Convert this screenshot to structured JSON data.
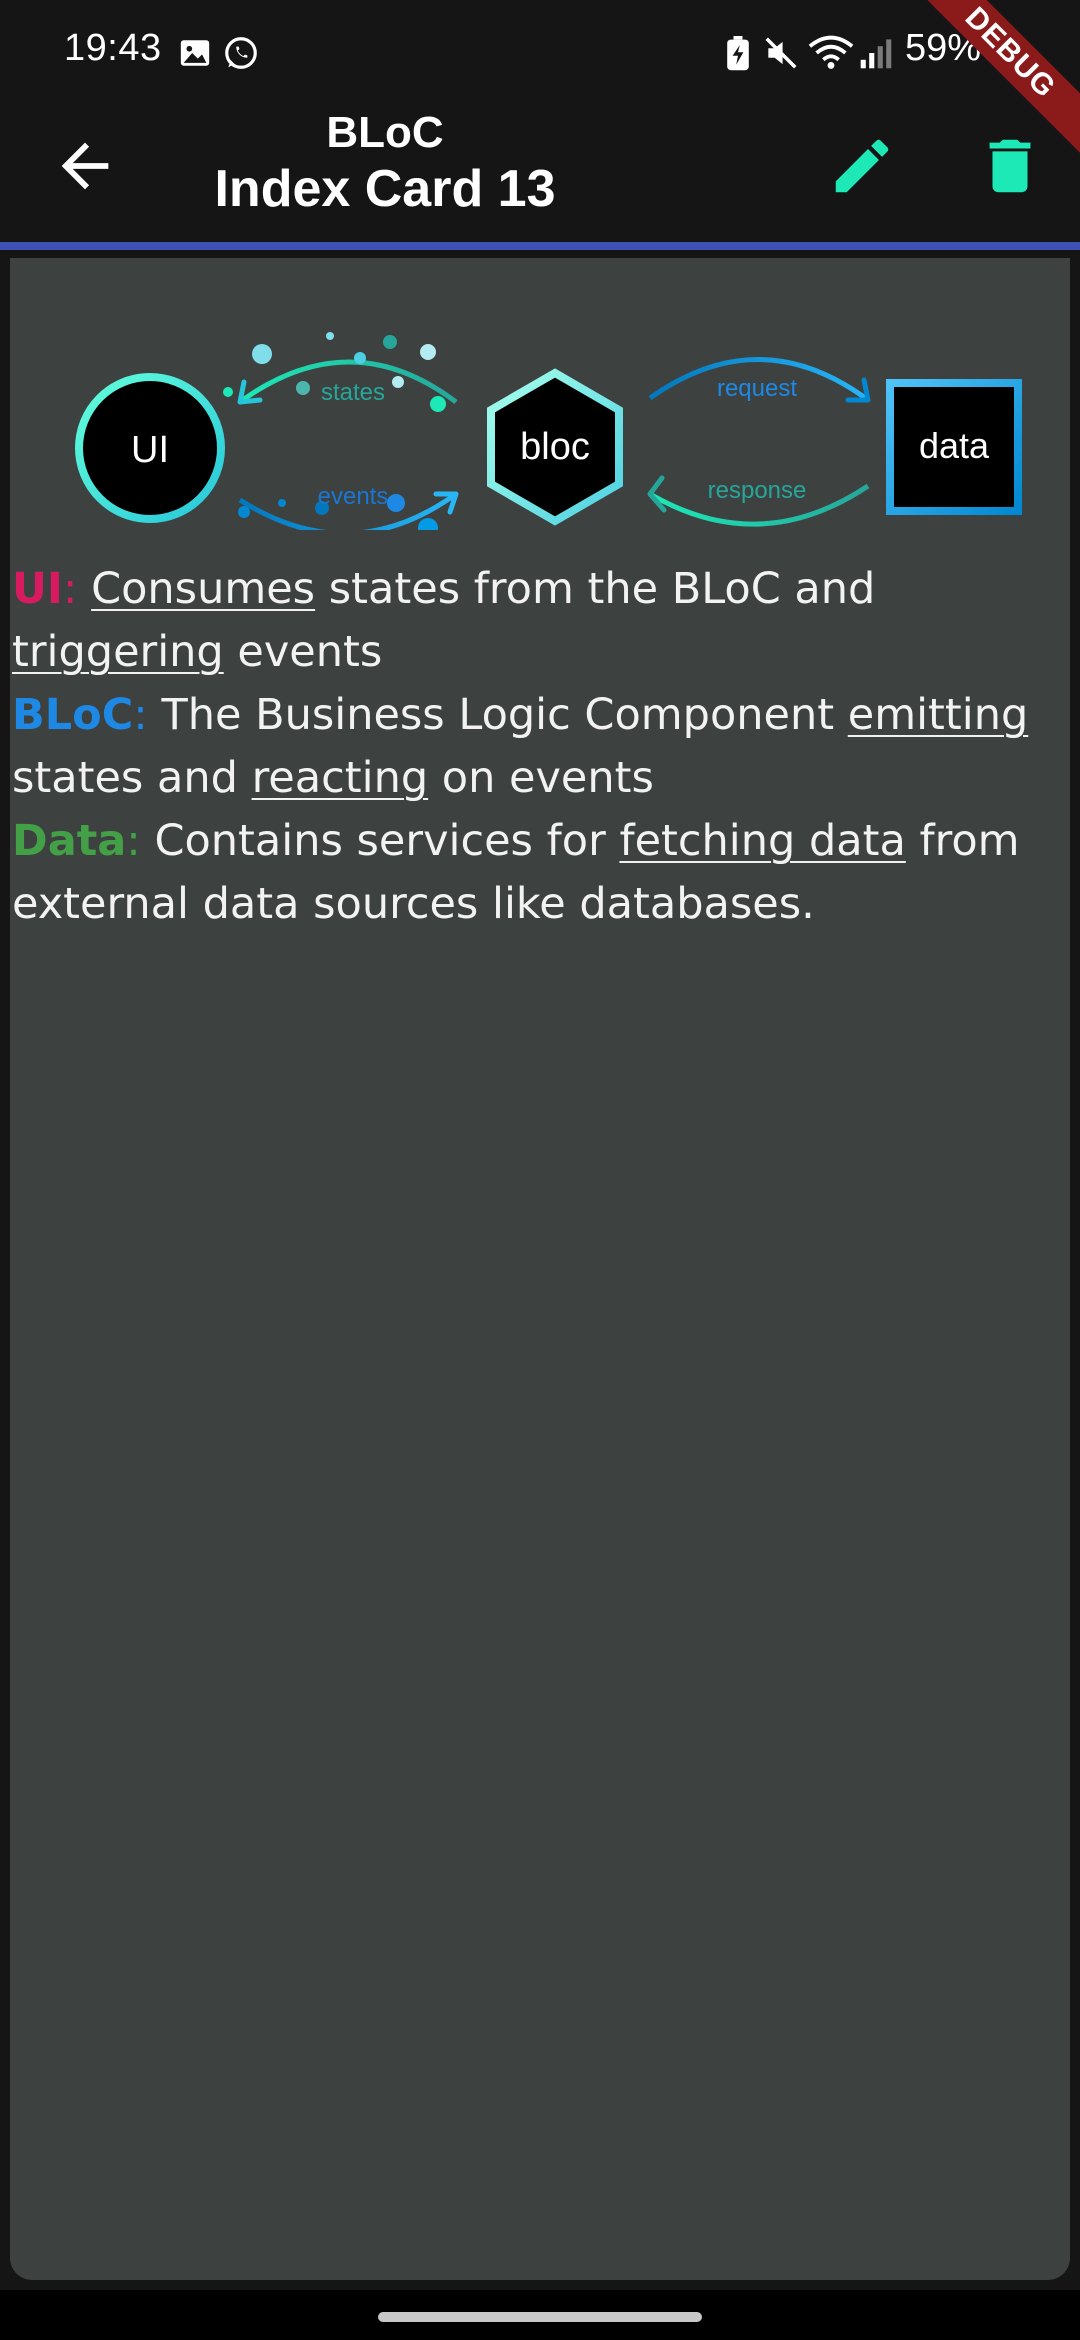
{
  "status_bar": {
    "time": "19:43",
    "battery": "59%",
    "icons": [
      "image-icon",
      "whatsapp-icon",
      "battery-saver-icon",
      "mute-icon",
      "wifi-icon",
      "signal-icon",
      "battery-icon"
    ]
  },
  "app_bar": {
    "title_line1": "BLoC",
    "title_line2": "Index Card 13",
    "back_icon": "arrow-back-icon",
    "edit_icon": "pencil-icon",
    "delete_icon": "trash-icon",
    "accent_color": "#1de9b6",
    "divider_color": "#3f51b5"
  },
  "debug_banner": "DEBUG",
  "diagram": {
    "ui": "UI",
    "bloc": "bloc",
    "data": "data",
    "states": "states",
    "events": "events",
    "request": "request",
    "response": "response"
  },
  "card": {
    "line1": {
      "label": "UI",
      "sep": ":",
      "w1": "Consumes",
      "t1": " states from the BLoC and ",
      "w2": "triggering",
      "t2": " events"
    },
    "line2": {
      "label": "BLoC",
      "sep": ":",
      "t0": " The Business Logic Component ",
      "w1": "emitting",
      "t1": " states and ",
      "w2": "reacting",
      "t2": " on events"
    },
    "line3": {
      "label": "Data",
      "sep": ":",
      "t0": " Contains services for ",
      "w1": "fetching data",
      "t1": " from external data sources like databases."
    },
    "label_colors": {
      "ui": "#d81b60",
      "bloc": "#1e88e5",
      "data": "#43a047"
    }
  }
}
